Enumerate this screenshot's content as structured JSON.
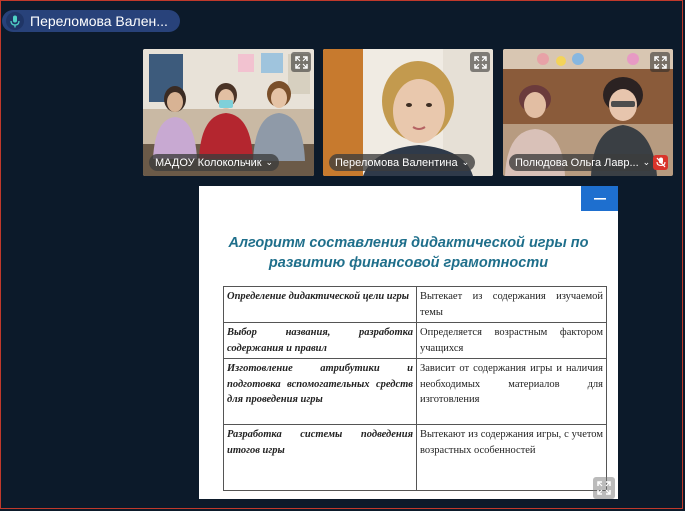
{
  "speaker": {
    "name": "Переломова Вален..."
  },
  "tiles": [
    {
      "label": "МАДОУ Колокольчик",
      "muted": false
    },
    {
      "label": "Переломова Валентина",
      "muted": false
    },
    {
      "label": "Полюдова Ольга Лавр...",
      "muted": true
    }
  ],
  "slide": {
    "title_line1": "Алгоритм составления дидактической игры по",
    "title_line2": "развитию финансовой грамотности",
    "rows": [
      {
        "step": "Определение дидактической цели игры",
        "note": "Вытекает из содержания изучаемой темы"
      },
      {
        "step": "Выбор названия, разработка содержания и правил",
        "note": "Определяется возрастным фактором учащихся"
      },
      {
        "step": "Изготовление атрибутики и подготовка вспомогательных средств для проведения игры",
        "note": "Зависит от содержания игры и наличия необходимых материалов для изготовления"
      },
      {
        "step": "Разработка системы подведения итогов игры",
        "note": "Вытекают из содержания игры, с учетом возрастных особенностей"
      }
    ]
  },
  "colors": {
    "background": "#0c1a2a",
    "pill": "#28427a",
    "accent_blue": "#1e6fcf",
    "title_teal": "#1f6f8b",
    "muted_red": "#d9342b"
  }
}
